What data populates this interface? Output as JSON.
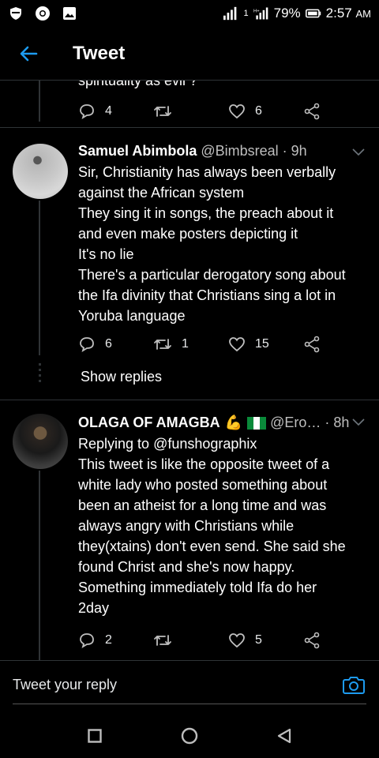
{
  "status_bar": {
    "battery": "79%",
    "time": "2:57",
    "ampm": "AM",
    "sim1": "1",
    "signal_label": "H+"
  },
  "header": {
    "title": "Tweet"
  },
  "previous_tweet": {
    "clipped_text": "spirituality as evil ?",
    "replies": "4",
    "likes": "6"
  },
  "tweets": [
    {
      "name": "Samuel Abimbola",
      "handle": "@Bimbsreal",
      "time": "· 9h",
      "lines": [
        "Sir, Christianity has always been verbally",
        "against the African system",
        "They sing it in songs, the preach about it",
        "and even make posters depicting it",
        "It's no lie",
        "There's a particular derogatory song about",
        "the Ifa divinity that Christians sing a lot in",
        "Yoruba language"
      ],
      "replies": "6",
      "retweets": "1",
      "likes": "15",
      "show_replies": "Show replies"
    },
    {
      "name": "OLAGA OF AMAGBA",
      "emoji": "💪",
      "handle": "@Ero…",
      "time": "· 8h",
      "replying_to_label": "Replying to",
      "replying_to_handle": "@funshographix",
      "lines": [
        "This tweet is like the opposite tweet of a",
        "white lady who posted something about",
        "been an atheist for a long time and was",
        "always angry with Christians while",
        "they(xtains) don't even send. She said she",
        "found Christ and she's now happy.",
        "Something immediately told Ifa do her",
        "2day"
      ],
      "replies": "2",
      "likes": "5"
    }
  ],
  "composer": {
    "placeholder": "Tweet your reply"
  },
  "colors": {
    "accent": "#1d9bf0",
    "background": "#000000",
    "divider": "#2f3336",
    "text": "#ffffff"
  }
}
